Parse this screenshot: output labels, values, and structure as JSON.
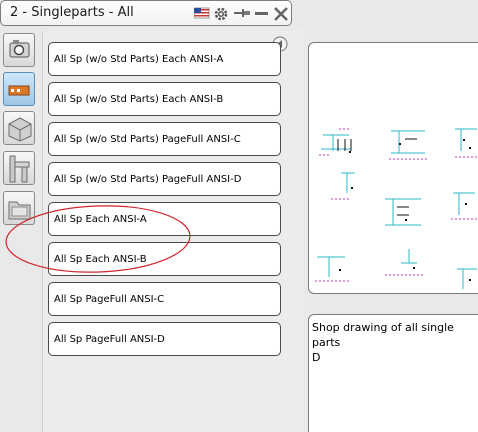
{
  "window": {
    "title": "2 - Singleparts - All"
  },
  "titlebar_icons": [
    "flag-us-icon",
    "gear-icon",
    "pin-icon",
    "minimize-icon",
    "close-icon"
  ],
  "toolbar": {
    "buttons": [
      "camera-icon",
      "single-part-icon",
      "assembly-icon",
      "beam-icon",
      "folder-icon"
    ],
    "active_index": 1
  },
  "list": {
    "items": [
      {
        "label": "All Sp (w/o Std Parts) Each ANSI-A"
      },
      {
        "label": "All Sp (w/o Std Parts) Each ANSI-B"
      },
      {
        "label": "All Sp (w/o Std Parts) PageFull ANSI-C"
      },
      {
        "label": "All Sp (w/o Std Parts) PageFull ANSI-D"
      },
      {
        "label": "All Sp Each ANSI-A"
      },
      {
        "label": "All Sp Each ANSI-B"
      },
      {
        "label": "All Sp PageFull ANSI-C"
      },
      {
        "label": "All Sp PageFull ANSI-D"
      }
    ]
  },
  "description": {
    "line1": "Shop drawing of all single parts",
    "line2": "D"
  },
  "colors": {
    "annotation": "#d0252a",
    "drawing_cyan": "#2bb8c9",
    "drawing_magenta": "#c83ab8"
  }
}
